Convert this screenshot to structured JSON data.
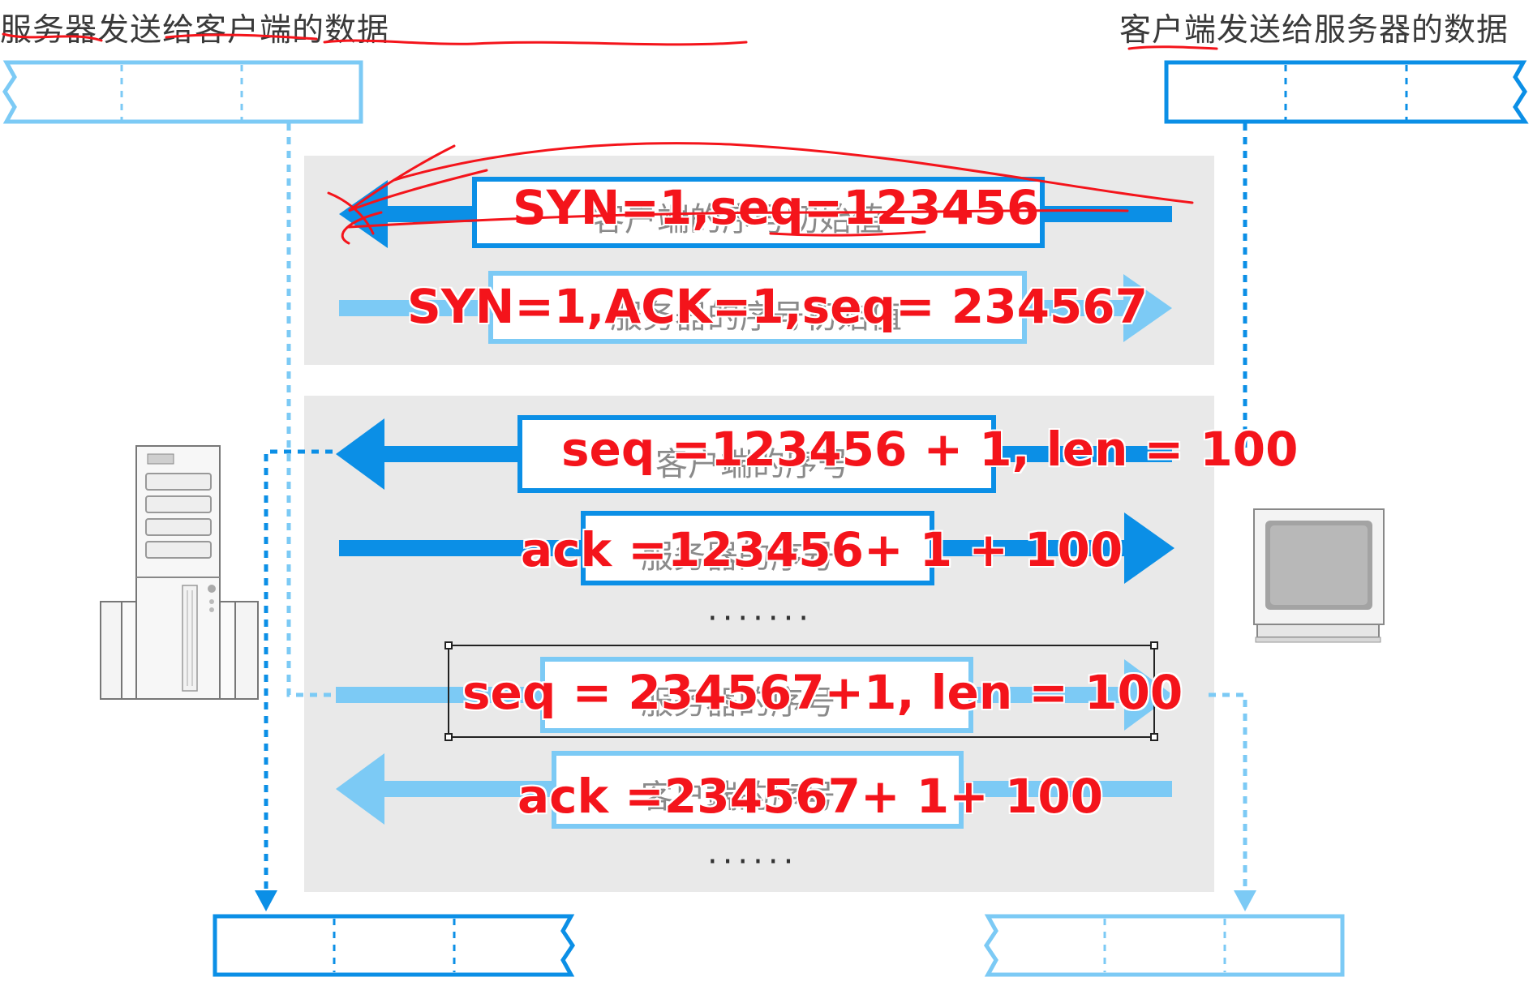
{
  "captions": {
    "left": "服务器发送给客户端的数据",
    "right": "客户端发送给服务器的数据"
  },
  "colors": {
    "blue_dark": "#0b8fe6",
    "blue_light": "#7ccaf5",
    "panel_gray": "#e9e9e9",
    "annotation_red": "#f4141b"
  },
  "messages": [
    {
      "id": "m1",
      "faint": "客户端的序号初始值",
      "annotation": "SYN=1,seq=123456",
      "direction": "to-server"
    },
    {
      "id": "m2",
      "faint": "服务器的序号初始值",
      "annotation": "SYN=1,ACK=1,seq= 234567",
      "direction": "to-client"
    },
    {
      "id": "m3",
      "faint": "客户端的序号",
      "annotation": "seq =123456 + 1, len = 100",
      "direction": "to-server"
    },
    {
      "id": "m4",
      "faint": "服务器的序号",
      "annotation": "ack =123456+ 1 + 100",
      "direction": "to-client"
    },
    {
      "id": "m5",
      "faint": "服务器的序号",
      "annotation": "seq = 234567+1, len = 100",
      "direction": "to-client"
    },
    {
      "id": "m6",
      "faint": "客户端的序号",
      "annotation": "ack =234567+ 1+ 100",
      "direction": "to-server"
    }
  ],
  "ellipsis": [
    "·······",
    "······"
  ],
  "icons": {
    "server": "server-tower-icon",
    "client": "desktop-monitor-icon"
  }
}
